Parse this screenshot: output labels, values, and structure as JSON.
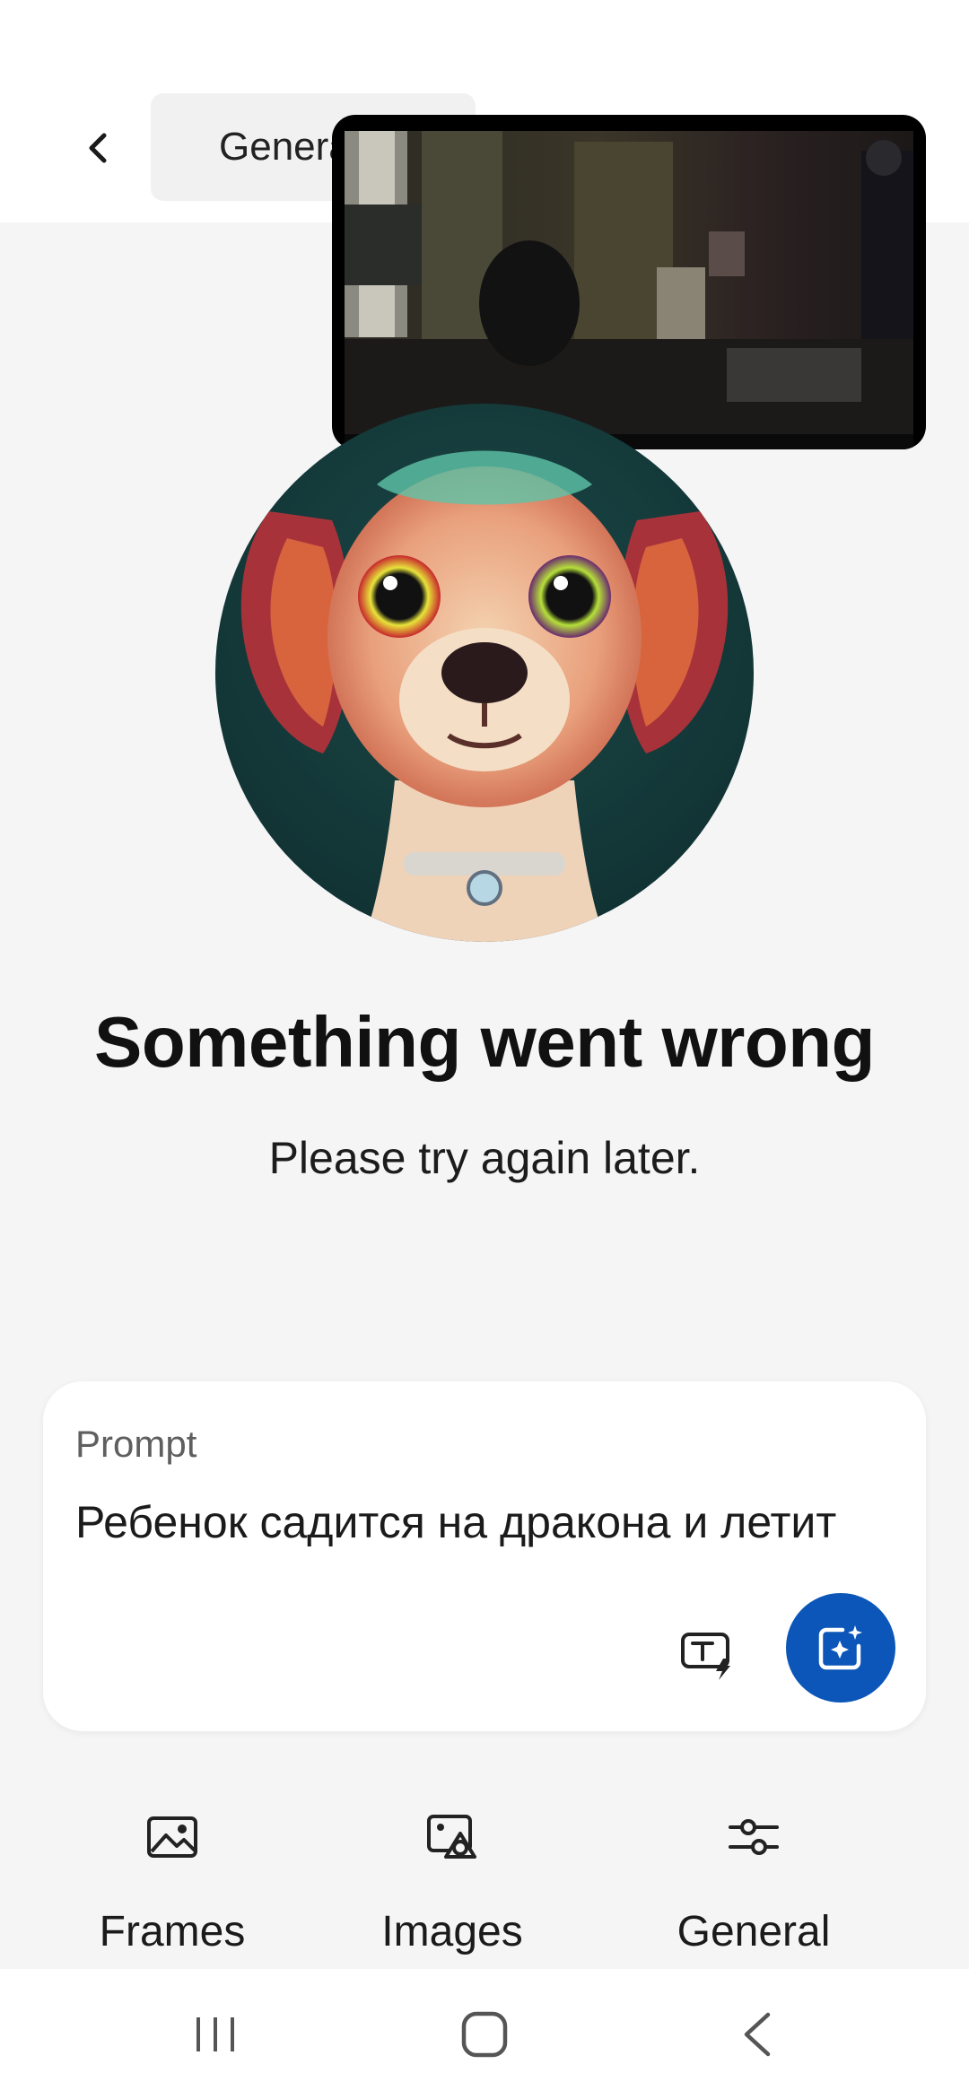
{
  "header": {
    "back_icon": "chevron-left-icon",
    "chip_label": "Genera"
  },
  "pip_video": {
    "description_icon": "video-preview"
  },
  "hero": {
    "image_icon": "dog-illustration"
  },
  "message": {
    "title": "Something went wrong",
    "subtitle": "Please try again later."
  },
  "prompt": {
    "label": "Prompt",
    "value": "Ребенок садится на дракона и летит",
    "text_effect_icon": "text-effects-icon",
    "generate_icon": "generate-sparkle-icon",
    "accent_color": "#0b56b8"
  },
  "tabs": [
    {
      "label": "Frames",
      "icon": "frames-image-icon"
    },
    {
      "label": "Images",
      "icon": "images-style-icon"
    },
    {
      "label": "General",
      "icon": "sliders-icon"
    }
  ],
  "navbar": {
    "recents_icon": "recents-icon",
    "home_icon": "home-icon",
    "back_icon": "back-icon"
  }
}
